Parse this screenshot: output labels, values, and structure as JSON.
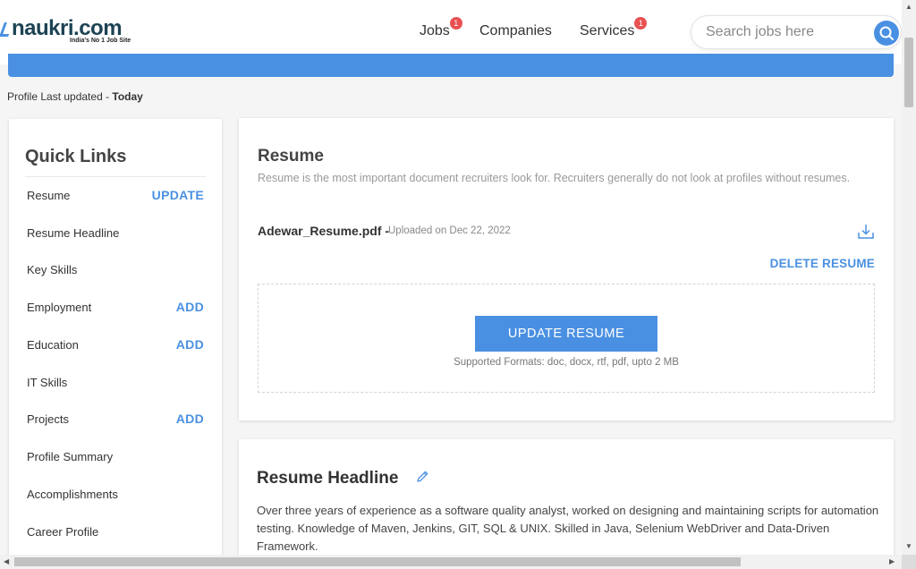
{
  "logo": {
    "name": "naukri.com",
    "tagline": "India's No 1 Job Site"
  },
  "nav": [
    {
      "label": "Jobs",
      "badge": "1"
    },
    {
      "label": "Companies"
    },
    {
      "label": "Services",
      "badge": "1"
    }
  ],
  "search": {
    "placeholder": "Search jobs here"
  },
  "profile_updated": {
    "prefix": "Profile Last updated - ",
    "value": "Today"
  },
  "quick_links": {
    "title": "Quick Links",
    "items": [
      {
        "label": "Resume",
        "action": "UPDATE"
      },
      {
        "label": "Resume Headline"
      },
      {
        "label": "Key Skills"
      },
      {
        "label": "Employment",
        "action": "ADD"
      },
      {
        "label": "Education",
        "action": "ADD"
      },
      {
        "label": "IT Skills"
      },
      {
        "label": "Projects",
        "action": "ADD"
      },
      {
        "label": "Profile Summary"
      },
      {
        "label": "Accomplishments"
      },
      {
        "label": "Career Profile"
      }
    ]
  },
  "resume": {
    "title": "Resume",
    "description": "Resume is the most important document recruiters look for. Recruiters generally do not look at profiles without resumes.",
    "file_name": "Adewar_Resume.pdf -",
    "uploaded": "Uploaded on Dec 22, 2022",
    "delete_label": "DELETE RESUME",
    "update_label": "UPDATE RESUME",
    "formats": "Supported Formats: doc, docx, rtf, pdf, upto 2 MB"
  },
  "headline": {
    "title": "Resume Headline",
    "text": "Over three years of experience as a software quality analyst, worked on designing and maintaining scripts for automation testing. Knowledge of Maven, Jenkins, GIT, SQL & UNIX. Skilled in Java, Selenium WebDriver and Data-Driven Framework."
  },
  "icons": {
    "search": "search-icon",
    "download": "download-icon",
    "edit": "pencil-icon"
  },
  "colors": {
    "accent": "#4a90e2",
    "badge": "#e95151",
    "brand": "#1d4354"
  }
}
